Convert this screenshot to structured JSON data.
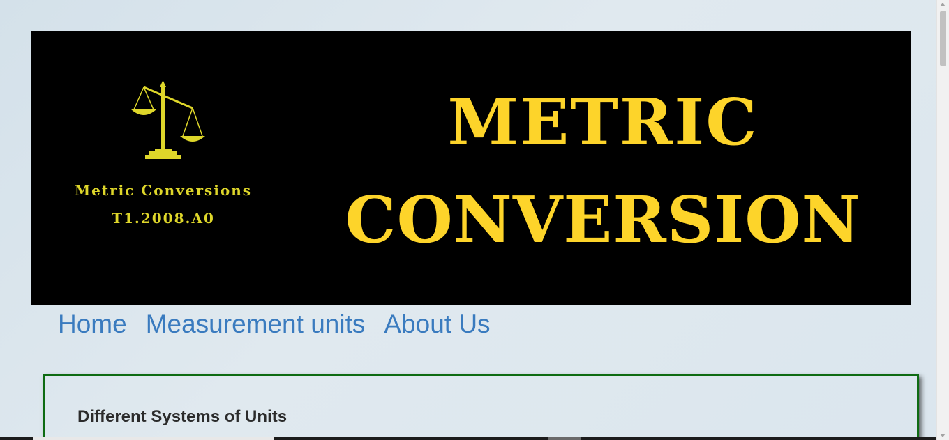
{
  "banner": {
    "logo_name": "Metric Conversions",
    "logo_code": "T1.2008.A0",
    "title_line1": "METRIC",
    "title_line2": "CONVERSION",
    "title_color": "#fdd42a",
    "logo_color": "#ded62a",
    "background": "#000000",
    "logo_icon": "scales-of-justice-icon"
  },
  "nav": {
    "items": [
      {
        "label": "Home"
      },
      {
        "label": "Measurement units"
      },
      {
        "label": "About Us"
      }
    ],
    "link_color": "#3a7bbf"
  },
  "content": {
    "heading": "Different Systems of Units",
    "border_color": "#0e6b12"
  }
}
